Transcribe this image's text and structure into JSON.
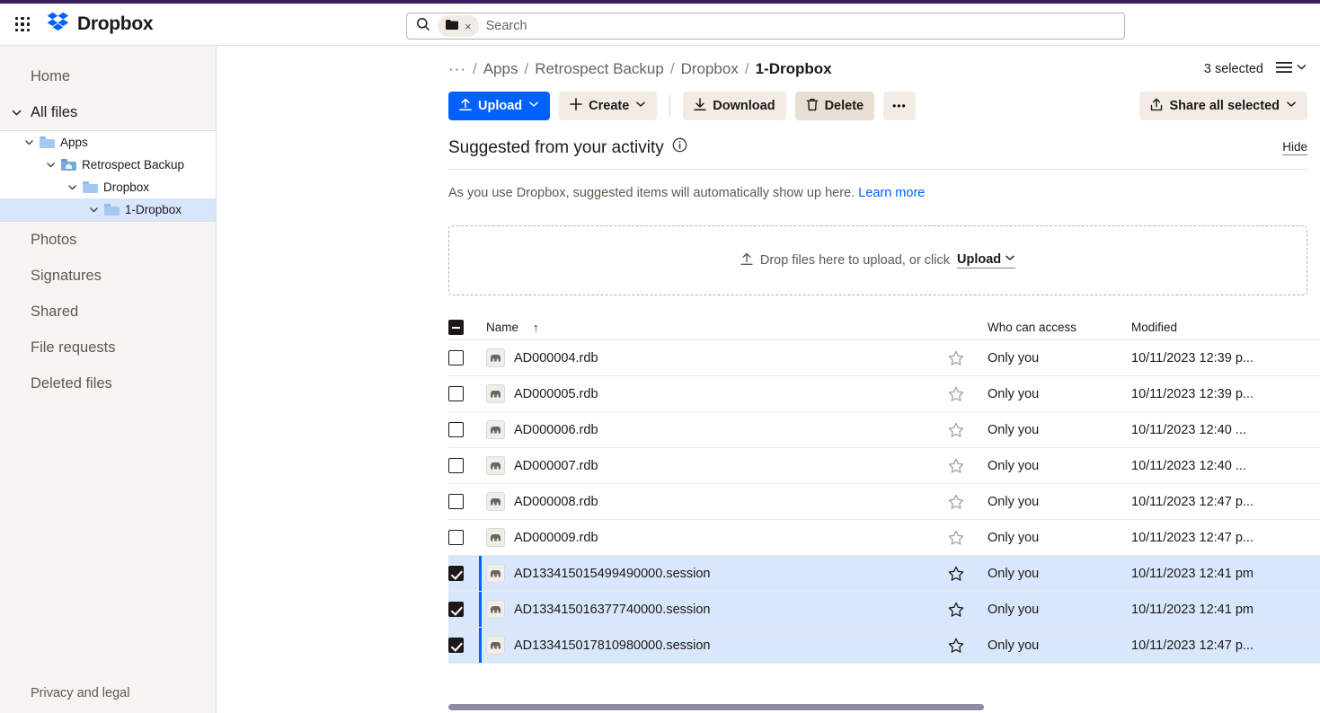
{
  "header": {
    "app_grid_icon": "apps-grid-icon",
    "brand": "Dropbox",
    "brand_logo_icon": "dropbox-logo-icon",
    "search": {
      "icon": "search-icon",
      "placeholder": "Search",
      "value": "",
      "chip_icon": "folder-icon",
      "chip_remove": "×"
    }
  },
  "sidebar": {
    "home": "Home",
    "all_files": "All files",
    "tree": [
      {
        "label": "Apps",
        "icon": "folder-icon",
        "depth": 0,
        "expanded": true,
        "selected": false
      },
      {
        "label": "Retrospect Backup",
        "icon": "app-folder-icon",
        "depth": 1,
        "expanded": true,
        "selected": false
      },
      {
        "label": "Dropbox",
        "icon": "folder-icon",
        "depth": 2,
        "expanded": true,
        "selected": false
      },
      {
        "label": "1-Dropbox",
        "icon": "folder-icon",
        "depth": 3,
        "expanded": true,
        "selected": true
      }
    ],
    "items": [
      {
        "label": "Photos"
      },
      {
        "label": "Signatures"
      },
      {
        "label": "Shared"
      },
      {
        "label": "File requests"
      },
      {
        "label": "Deleted files"
      }
    ],
    "privacy": "Privacy and legal"
  },
  "breadcrumb": {
    "overflow": "···",
    "separator": "/",
    "items": [
      {
        "label": "Apps"
      },
      {
        "label": "Retrospect Backup"
      },
      {
        "label": "Dropbox"
      },
      {
        "label": "1-Dropbox"
      }
    ],
    "selected_count": "3 selected",
    "view_icon": "list-view-icon",
    "view_chevron": "chevron-down-icon"
  },
  "toolbar": {
    "upload": "Upload",
    "upload_icon": "upload-icon",
    "create": "Create",
    "create_icon": "plus-icon",
    "download": "Download",
    "download_icon": "download-icon",
    "delete": "Delete",
    "delete_icon": "trash-icon",
    "more": "•••",
    "share_all": "Share all selected",
    "share_icon": "share-icon"
  },
  "suggested": {
    "title": "Suggested from your activity",
    "info_icon": "info-icon",
    "hide": "Hide",
    "body_text": "As you use Dropbox, suggested items will automatically show up here.",
    "learn_more": "Learn more"
  },
  "dropzone": {
    "icon": "upload-icon",
    "text": "Drop files here to upload, or click",
    "upload_label": "Upload"
  },
  "table": {
    "columns": {
      "name": "Name",
      "sort_arrow": "↑",
      "access": "Who can access",
      "modified": "Modified"
    },
    "rows": [
      {
        "name": "AD000004.rdb",
        "access": "Only you",
        "modified": "10/11/2023 12:39 p...",
        "selected": false
      },
      {
        "name": "AD000005.rdb",
        "access": "Only you",
        "modified": "10/11/2023 12:39 p...",
        "selected": false
      },
      {
        "name": "AD000006.rdb",
        "access": "Only you",
        "modified": "10/11/2023 12:40 ...",
        "selected": false
      },
      {
        "name": "AD000007.rdb",
        "access": "Only you",
        "modified": "10/11/2023 12:40 ...",
        "selected": false
      },
      {
        "name": "AD000008.rdb",
        "access": "Only you",
        "modified": "10/11/2023 12:47 p...",
        "selected": false
      },
      {
        "name": "AD000009.rdb",
        "access": "Only you",
        "modified": "10/11/2023 12:47 p...",
        "selected": false
      },
      {
        "name": "AD133415015499490000.session",
        "access": "Only you",
        "modified": "10/11/2023 12:41 pm",
        "selected": true
      },
      {
        "name": "AD133415016377740000.session",
        "access": "Only you",
        "modified": "10/11/2023 12:41 pm",
        "selected": true
      },
      {
        "name": "AD133415017810980000.session",
        "access": "Only you",
        "modified": "10/11/2023 12:47 p...",
        "selected": true
      }
    ]
  },
  "colors": {
    "accent": "#0061fe",
    "selected_row": "#d8e7fb",
    "sidebar_bg": "#f7f5f2",
    "button_ghost": "#f2ece4",
    "top_strip": "#3a1d5b"
  }
}
